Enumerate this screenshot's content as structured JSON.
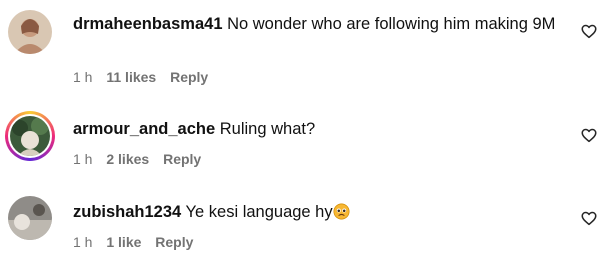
{
  "comments": [
    {
      "username": "drmaheenbasma41",
      "text": "No wonder who are following him making 9M",
      "time": "1 h",
      "likes": "11 likes",
      "reply": "Reply",
      "has_story_ring": false
    },
    {
      "username": "armour_and_ache",
      "text": "Ruling what?",
      "time": "1 h",
      "likes": "2 likes",
      "reply": "Reply",
      "has_story_ring": true
    },
    {
      "username": "zubishah1234",
      "text": "Ye kesi language hy",
      "time": "1 h",
      "likes": "1 like",
      "reply": "Reply",
      "has_story_ring": false,
      "trailing_emoji": "pleading-face-emoji"
    }
  ],
  "icons": {
    "like": "heart-outline-icon"
  },
  "colors": {
    "text": "#111111",
    "meta": "#737373",
    "story_ring": [
      "#f9ce34",
      "#ee2a7b",
      "#6228d7"
    ]
  }
}
